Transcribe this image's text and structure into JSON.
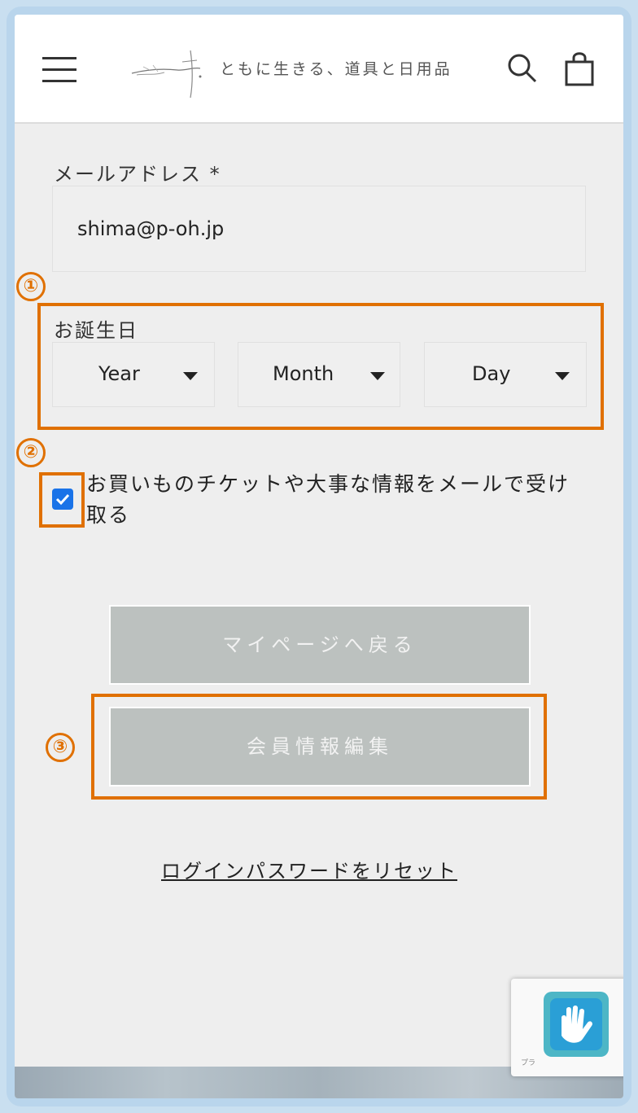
{
  "header": {
    "tagline": "ともに生きる、道具と日用品",
    "menu_icon": "hamburger-icon",
    "search_icon": "search-icon",
    "cart_icon": "shopping-bag-icon"
  },
  "form": {
    "email_label": "メールアドレス *",
    "email_value": "shima@p-oh.jp",
    "birthday_label": "お誕生日",
    "year_select": "Year",
    "month_select": "Month",
    "day_select": "Day",
    "newsletter_checked": true,
    "newsletter_label": "お買いものチケットや大事な情報をメールで受け取る"
  },
  "buttons": {
    "back_label": "マイページへ戻る",
    "edit_label": "会員情報編集"
  },
  "links": {
    "reset_password": "ログインパスワードをリセット"
  },
  "annotations": {
    "marker_1": "①",
    "marker_2": "②",
    "marker_3": "③",
    "color": "#e07000"
  },
  "colors": {
    "page_bg": "#eeeeee",
    "button_bg": "#bcc1bf",
    "checkbox": "#1a73e8",
    "frame": "#b9d5ec"
  }
}
